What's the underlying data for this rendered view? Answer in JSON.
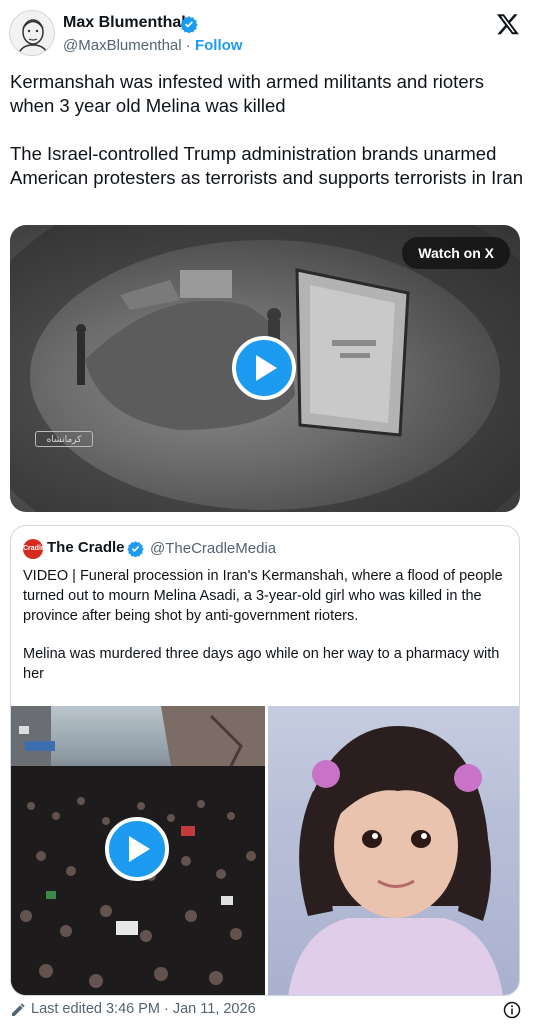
{
  "author": {
    "name": "Max Blumenthal",
    "handle": "@MaxBlumenthal",
    "separator": "·",
    "follow_label": "Follow"
  },
  "tweet": {
    "paragraph1": "Kermanshah was infested with armed militants and rioters when 3 year old Melina was killed",
    "paragraph2": "The Israel-controlled Trump administration brands unarmed American protesters as terrorists and supports terrorists in Iran"
  },
  "video": {
    "watch_label": "Watch on X",
    "watermark": "کرمانشاه"
  },
  "quote": {
    "avatar_text": "Cradle",
    "name": "The Cradle",
    "handle": "@TheCradleMedia",
    "paragraph1": "VIDEO | Funeral procession in Iran's Kermanshah, where a flood of people turned out to mourn Melina Asadi, a 3-year-old girl who was killed in the province after being shot by anti-government rioters.",
    "paragraph2": "Melina was murdered three days ago while on her way to a pharmacy with her"
  },
  "footer": {
    "edited": "Last edited 3:46 PM · Jan 11, 2026"
  },
  "icons": {
    "verified": "verified-badge-icon",
    "x_logo": "x-logo-icon",
    "play": "play-icon",
    "pencil": "pencil-icon",
    "info": "info-icon"
  },
  "colors": {
    "accent": "#1d9bf0",
    "text": "#0f1419",
    "muted": "#536471",
    "border": "#cfd9de"
  }
}
